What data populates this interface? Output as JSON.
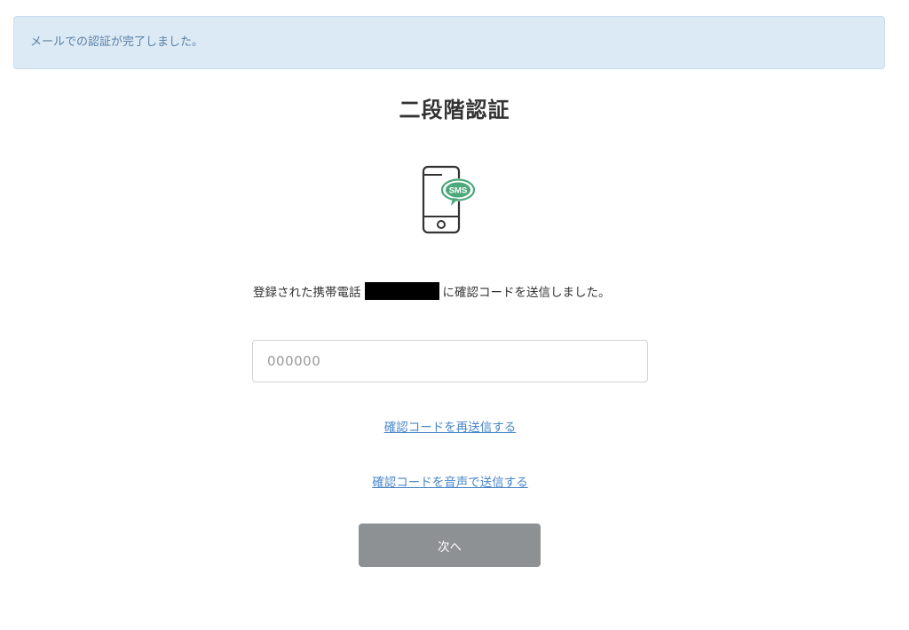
{
  "alert": {
    "text": "メールでの認証が完了しました。"
  },
  "page": {
    "title": "二段階認証"
  },
  "icon": {
    "name": "sms-phone-icon",
    "bubble_text": "SMS",
    "accent_color": "#4aa87a",
    "outline_color": "#333333"
  },
  "message": {
    "before": "登録された携帯電話",
    "after": "に確認コードを送信しました。"
  },
  "code_input": {
    "value": "",
    "placeholder": "000000"
  },
  "links": {
    "resend": "確認コードを再送信する",
    "voice": "確認コードを音声で送信する"
  },
  "next_button": {
    "label": "次へ"
  },
  "colors": {
    "alert_bg": "#dceaf5",
    "alert_text": "#5a7fa3",
    "link": "#4a86c8",
    "button_bg": "#8e9194"
  }
}
